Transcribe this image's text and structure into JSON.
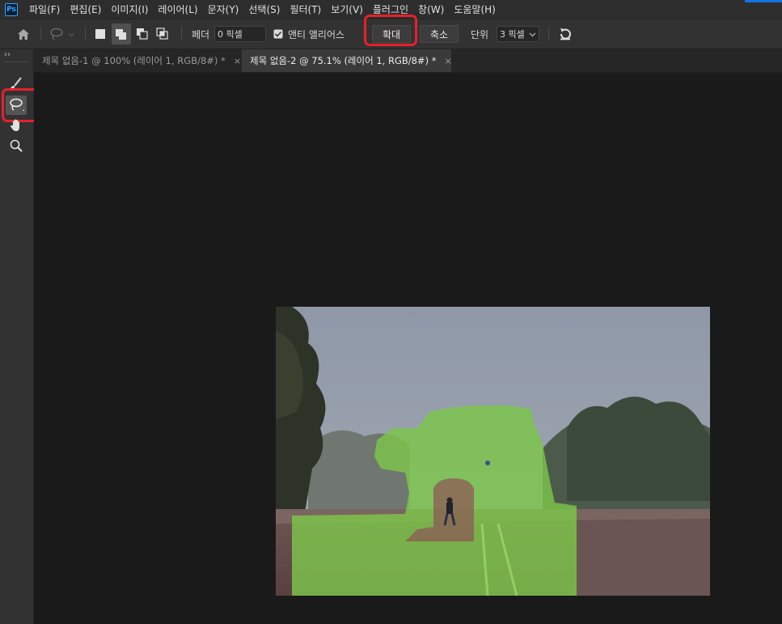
{
  "app": {
    "logo": "Ps"
  },
  "menu": [
    "파일(F)",
    "편집(E)",
    "이미지(I)",
    "레이어(L)",
    "문자(Y)",
    "선택(S)",
    "필터(T)",
    "보기(V)",
    "플러그인",
    "창(W)",
    "도움말(H)"
  ],
  "options": {
    "feather_label": "페더",
    "feather_value": "0 픽셀",
    "antialias_label": "앤티 앨리어스",
    "expand_label": "확대",
    "contract_label": "축소",
    "unit_label": "단위",
    "unit_value": "3 픽셀"
  },
  "tabs": [
    {
      "label": "제목 없음-1 @ 100% (레이어 1, RGB/8#) *",
      "close": "×",
      "active": false
    },
    {
      "label": "제목 없음-2 @ 75.1% (레이어 1, RGB/8#) *",
      "close": "×",
      "active": true
    }
  ],
  "tools": [
    "brush-icon",
    "lasso-icon",
    "hand-icon",
    "zoom-icon"
  ],
  "colors": {
    "highlight": "#e8202a",
    "selection_overlay": "#7dc64a",
    "accent": "#1473e6"
  }
}
